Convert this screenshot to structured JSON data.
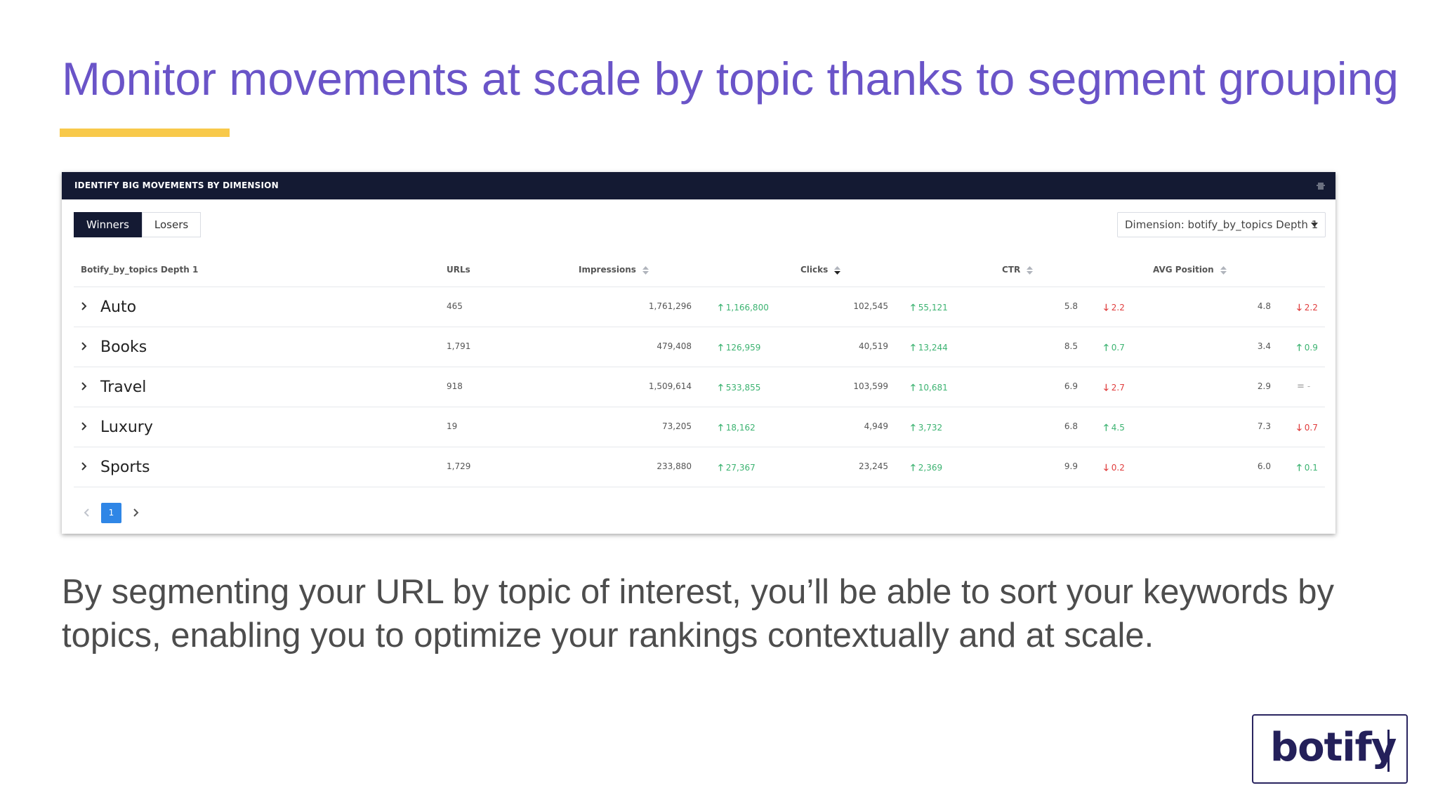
{
  "slide": {
    "title": "Monitor movements at scale by topic thanks to segment grouping",
    "body": "By segmenting your URL by topic of interest, you’ll be able to sort your keywords by topics, enabling you to optimize your rankings contextually and at scale.",
    "logo": "botify"
  },
  "panel": {
    "header_title": "IDENTIFY BIG MOVEMENTS BY DIMENSION",
    "tabs": [
      {
        "label": "Winners",
        "active": true
      },
      {
        "label": "Losers",
        "active": false
      }
    ],
    "dimension_select": "Dimension: botify_by_topics Depth 1",
    "columns": {
      "topic": "Botify_by_topics Depth 1",
      "urls": "URLs",
      "impressions": "Impressions",
      "clicks": "Clicks",
      "ctr": "CTR",
      "avg_position": "AVG Position"
    },
    "rows": [
      {
        "topic": "Auto",
        "urls": "465",
        "impressions": "1,761,296",
        "impressions_delta": "1,166,800",
        "impressions_dir": "up",
        "clicks": "102,545",
        "clicks_delta": "55,121",
        "clicks_dir": "up",
        "ctr": "5.8",
        "ctr_delta": "2.2",
        "ctr_dir": "down",
        "avg_position": "4.8",
        "pos_delta": "2.2",
        "pos_dir": "down"
      },
      {
        "topic": "Books",
        "urls": "1,791",
        "impressions": "479,408",
        "impressions_delta": "126,959",
        "impressions_dir": "up",
        "clicks": "40,519",
        "clicks_delta": "13,244",
        "clicks_dir": "up",
        "ctr": "8.5",
        "ctr_delta": "0.7",
        "ctr_dir": "up",
        "avg_position": "3.4",
        "pos_delta": "0.9",
        "pos_dir": "up"
      },
      {
        "topic": "Travel",
        "urls": "918",
        "impressions": "1,509,614",
        "impressions_delta": "533,855",
        "impressions_dir": "up",
        "clicks": "103,599",
        "clicks_delta": "10,681",
        "clicks_dir": "up",
        "ctr": "6.9",
        "ctr_delta": "2.7",
        "ctr_dir": "down",
        "avg_position": "2.9",
        "pos_delta": "-",
        "pos_dir": "neutral"
      },
      {
        "topic": "Luxury",
        "urls": "19",
        "impressions": "73,205",
        "impressions_delta": "18,162",
        "impressions_dir": "up",
        "clicks": "4,949",
        "clicks_delta": "3,732",
        "clicks_dir": "up",
        "ctr": "6.8",
        "ctr_delta": "4.5",
        "ctr_dir": "up",
        "avg_position": "7.3",
        "pos_delta": "0.7",
        "pos_dir": "down"
      },
      {
        "topic": "Sports",
        "urls": "1,729",
        "impressions": "233,880",
        "impressions_delta": "27,367",
        "impressions_dir": "up",
        "clicks": "23,245",
        "clicks_delta": "2,369",
        "clicks_dir": "up",
        "ctr": "9.9",
        "ctr_delta": "0.2",
        "ctr_dir": "down",
        "avg_position": "6.0",
        "pos_delta": "0.1",
        "pos_dir": "up"
      }
    ],
    "pagination": {
      "current_page": "1"
    },
    "colors": {
      "up": "#3cb371",
      "down": "#e03c3c",
      "header_bg": "#141a33",
      "accent": "#2f86e6"
    }
  }
}
